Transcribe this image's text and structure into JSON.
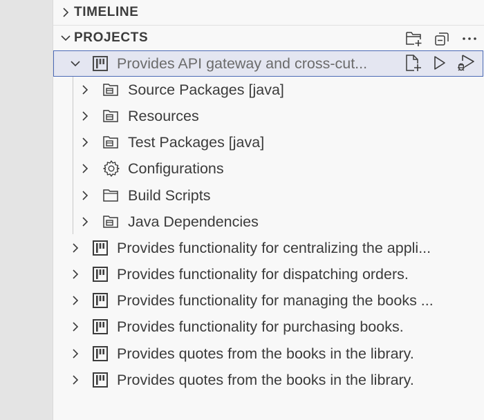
{
  "sections": {
    "timeline": {
      "title": "TIMELINE",
      "expanded": false
    },
    "projects": {
      "title": "PROJECTS",
      "expanded": true,
      "actions": [
        {
          "icon": "new-folder-icon"
        },
        {
          "icon": "collapse-all-icon"
        },
        {
          "icon": "more-actions-icon"
        }
      ]
    }
  },
  "tree": {
    "selected_project": {
      "label": "Provides API gateway and cross-cut...",
      "icon": "project-icon",
      "expanded": true,
      "actions": [
        {
          "icon": "new-file-icon"
        },
        {
          "icon": "run-icon"
        },
        {
          "icon": "debug-icon"
        }
      ],
      "children": [
        {
          "label": "Source Packages [java]",
          "icon": "packages-folder-icon"
        },
        {
          "label": "Resources",
          "icon": "packages-folder-icon"
        },
        {
          "label": "Test Packages [java]",
          "icon": "packages-folder-icon"
        },
        {
          "label": "Configurations",
          "icon": "gear-icon"
        },
        {
          "label": "Build Scripts",
          "icon": "folder-icon"
        },
        {
          "label": "Java Dependencies",
          "icon": "packages-folder-icon"
        }
      ]
    },
    "projects": [
      {
        "label": "Provides functionality for centralizing the appli...",
        "icon": "project-icon"
      },
      {
        "label": "Provides functionality for dispatching orders.",
        "icon": "project-icon"
      },
      {
        "label": "Provides functionality for managing the books ...",
        "icon": "project-icon"
      },
      {
        "label": "Provides functionality for purchasing books.",
        "icon": "project-icon"
      },
      {
        "label": "Provides quotes from the books in the library.",
        "icon": "project-icon"
      },
      {
        "label": "Provides quotes from the books in the library.",
        "icon": "project-icon"
      }
    ]
  },
  "colors": {
    "selection_background": "#e4e6f1",
    "selection_border": "#4a69b5",
    "text": "#3b3b3b"
  }
}
